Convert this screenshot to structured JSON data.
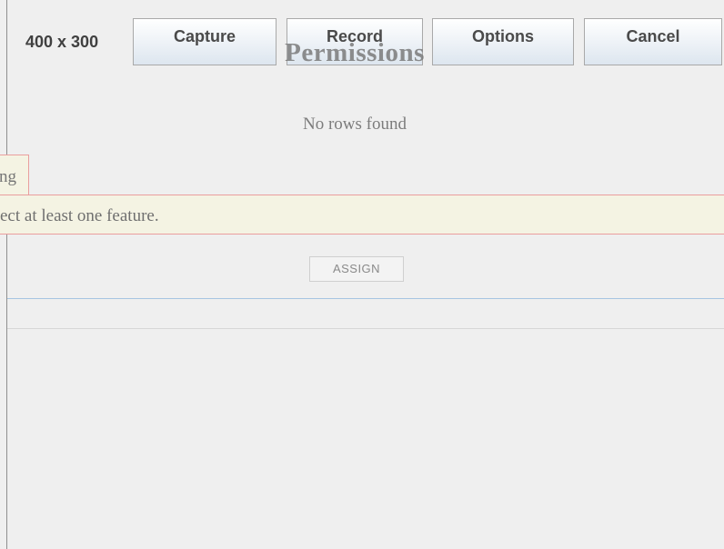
{
  "toolbar": {
    "size_label": "400 x 300",
    "capture_label": "Capture",
    "record_label": "Record",
    "options_label": "Options",
    "cancel_label": "Cancel"
  },
  "page": {
    "title": "Permissions",
    "empty_message": "No rows found"
  },
  "message": {
    "tab_text": "ng",
    "body_text": "ect at least one feature."
  },
  "actions": {
    "assign_label": "ASSIGN"
  },
  "colors": {
    "background": "#efefef",
    "message_background": "#f4f3e3",
    "message_border": "#ea9e9e",
    "divider_blue": "#a6c4e2"
  }
}
